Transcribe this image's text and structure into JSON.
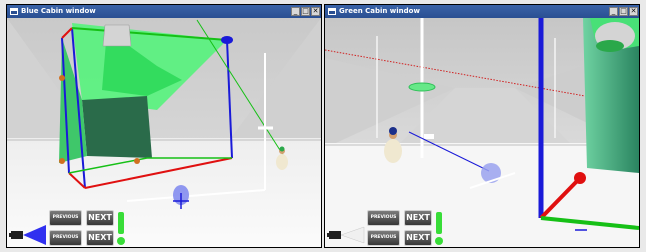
{
  "left_window": {
    "title": "Blue Cabin window",
    "controls": {
      "minimize": "_",
      "maximize": "□",
      "close": "✕"
    },
    "nav_rows": [
      {
        "previous": "PREVIOUS",
        "next": "NEXT"
      },
      {
        "previous": "PREVIOUS",
        "next": "NEXT"
      }
    ]
  },
  "right_window": {
    "title": "Green Cabin window",
    "controls": {
      "minimize": "_",
      "maximize": "□",
      "close": "✕"
    },
    "nav_rows": [
      {
        "previous": "PREVIOUS",
        "next": "NEXT"
      },
      {
        "previous": "PREVIOUS",
        "next": "NEXT"
      }
    ]
  },
  "colors": {
    "titlebar": "#2a4f92",
    "green_wall": "#54f27c",
    "frame_red": "#e01010",
    "frame_blue": "#1a1ad8",
    "frame_green": "#16c016",
    "exclamation": "#38dd38",
    "flashlight_cone": "#3030f0"
  },
  "icons": {
    "exclamation": "exclamation-icon",
    "flashlight": "flashlight-icon",
    "app": "window-icon"
  }
}
